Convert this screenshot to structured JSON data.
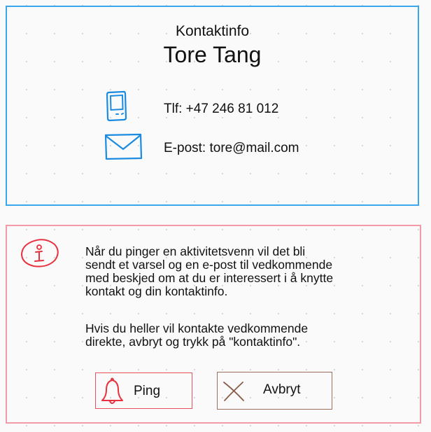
{
  "contact_card": {
    "heading": "Kontaktinfo",
    "name": "Tore Tang",
    "phone": "Tlf: +47 246 81 012",
    "email": "E-post: tore@mail.com",
    "phone_icon": "mobile-phone-icon",
    "email_icon": "envelope-icon",
    "border_color": "#3aa6ec"
  },
  "info_panel": {
    "paragraph_1_lines": [
      "Når du pinger en aktivitetsvenn vil det bli",
      "sendt et varsel og en e-post til vedkommende",
      "med beskjed om at du er interessert i å knytte",
      "kontakt og din kontaktinfo."
    ],
    "paragraph_2_lines": [
      "Hvis du heller vil kontakte vedkommende",
      "direkte, avbryt og trykk på \"kontaktinfo\"."
    ],
    "info_icon": "info-icon",
    "border_color": "#f29aa7"
  },
  "buttons": {
    "ping_label": "Ping",
    "ping_icon": "bell-icon",
    "ping_color": "#e8505b",
    "cancel_label": "Avbryt",
    "cancel_icon": "x-icon",
    "cancel_color": "#9c6f5a"
  }
}
